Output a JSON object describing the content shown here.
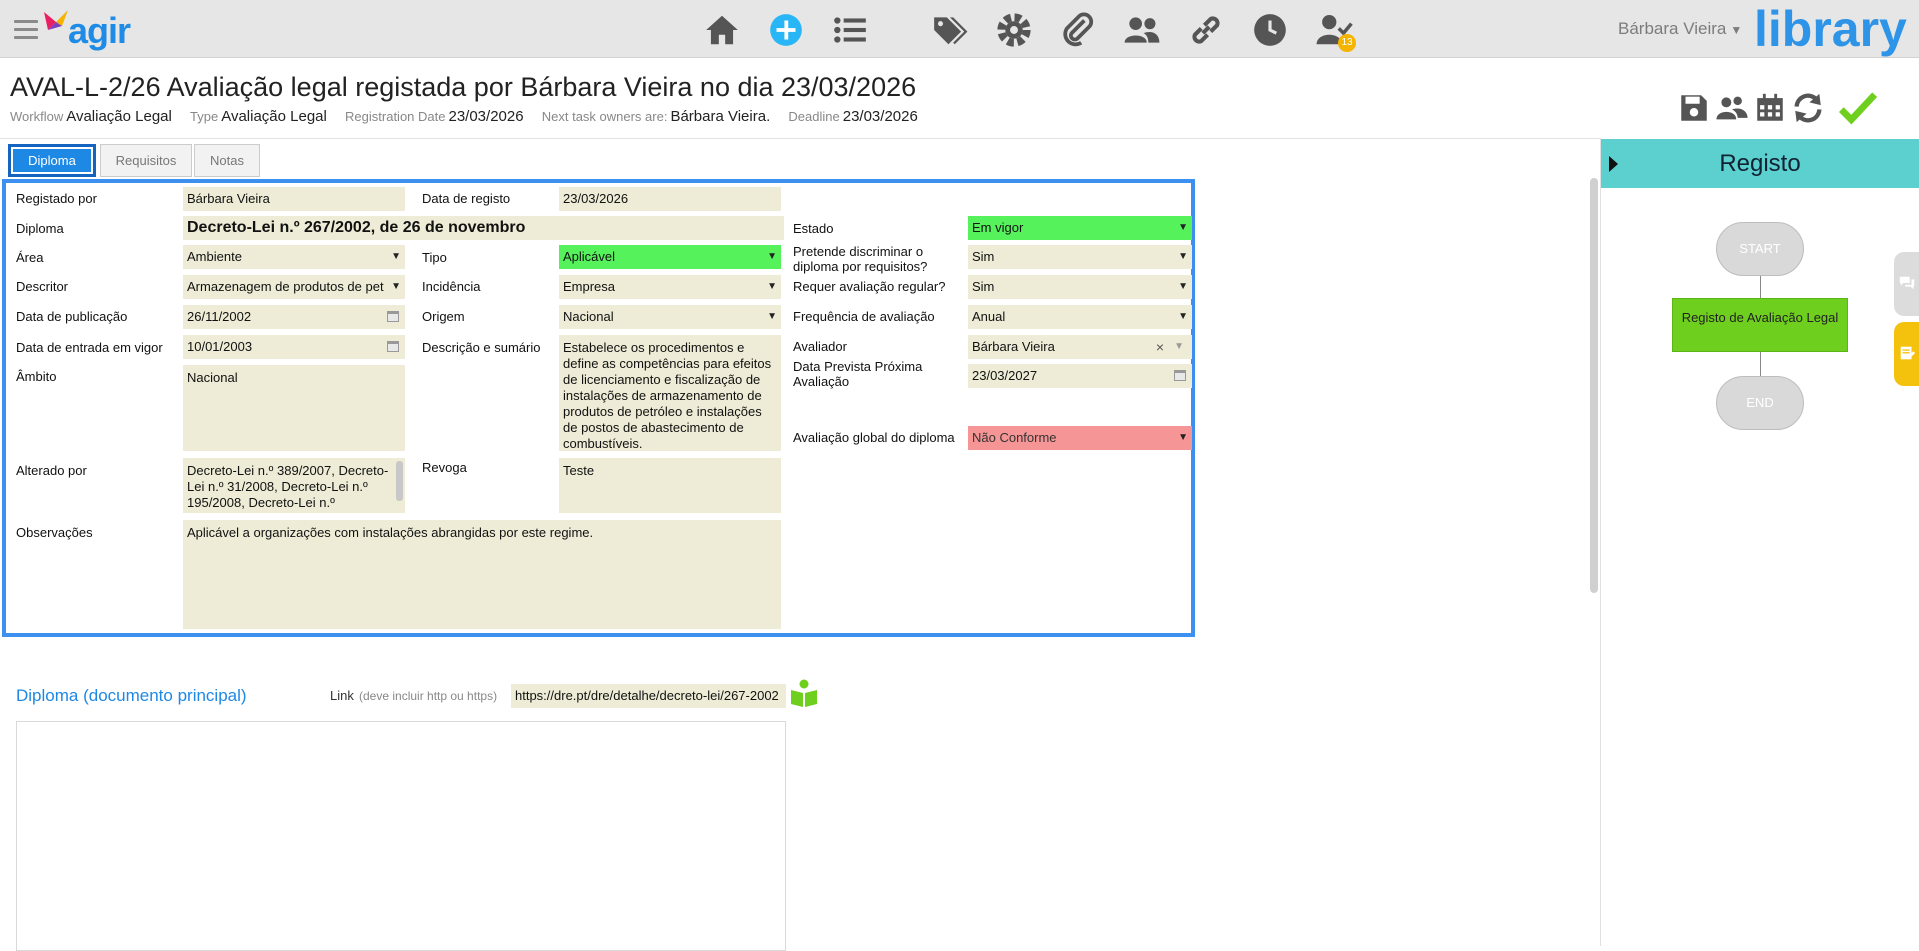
{
  "topbar": {
    "logo_text": "agir",
    "user_name": "Bárbara Vieira",
    "brand": "library",
    "notifications_count": "13",
    "nav_icons": [
      "home-icon",
      "add-icon",
      "list-icon",
      "tags-icon",
      "settings-icon",
      "attachment-icon",
      "users-icon",
      "link-icon",
      "clock-icon",
      "user-check-icon"
    ]
  },
  "header": {
    "title": "AVAL-L-2/26 Avaliação legal registada por Bárbara Vieira no dia 23/03/2026",
    "workflow_label": "Workflow",
    "workflow_value": "Avaliação Legal",
    "type_label": "Type",
    "type_value": "Avaliação Legal",
    "registration_label": "Registration Date",
    "registration_value": "23/03/2026",
    "owners_label": "Next task owners are:",
    "owners_value": "Bárbara Vieira.",
    "deadline_label": "Deadline",
    "deadline_value": "23/03/2026",
    "action_icons": [
      "save-icon",
      "group-icon",
      "calendar-icon",
      "refresh-icon",
      "check-icon"
    ]
  },
  "tabs": [
    {
      "label": "Diploma",
      "active": true
    },
    {
      "label": "Requisitos",
      "active": false
    },
    {
      "label": "Notas",
      "active": false
    }
  ],
  "form": {
    "registado_por": {
      "label": "Registado por",
      "value": "Bárbara Vieira"
    },
    "data_registo": {
      "label": "Data de registo",
      "value": "23/03/2026"
    },
    "diploma": {
      "label": "Diploma",
      "value": "Decreto-Lei n.º 267/2002, de 26 de novembro"
    },
    "estado": {
      "label": "Estado",
      "value": "Em vigor"
    },
    "area": {
      "label": "Área",
      "value": "Ambiente"
    },
    "tipo": {
      "label": "Tipo",
      "value": "Aplicável"
    },
    "discriminar": {
      "label": "Pretende discriminar o diploma por requisitos?",
      "value": "Sim"
    },
    "descritor": {
      "label": "Descritor",
      "value": "Armazenagem de produtos de pet"
    },
    "incidencia": {
      "label": "Incidência",
      "value": "Empresa"
    },
    "requer_avaliacao": {
      "label": "Requer avaliação regular?",
      "value": "Sim"
    },
    "data_publicacao": {
      "label": "Data de publicação",
      "value": "26/11/2002"
    },
    "origem": {
      "label": "Origem",
      "value": "Nacional"
    },
    "frequencia": {
      "label": "Frequência de avaliação",
      "value": "Anual"
    },
    "data_vigor": {
      "label": "Data de entrada em vigor",
      "value": "10/01/2003"
    },
    "descricao": {
      "label": "Descrição e sumário",
      "value": "Estabelece os procedimentos e define as competências para efeitos de licenciamento e fiscalização de instalações de armazenamento de produtos de petróleo e instalações de postos de abastecimento de combustíveis."
    },
    "avaliador": {
      "label": "Avaliador",
      "value": "Bárbara Vieira"
    },
    "data_prevista": {
      "label": "Data Prevista Próxima Avaliação",
      "value": "23/03/2027"
    },
    "ambito": {
      "label": "Âmbito",
      "value": "Nacional"
    },
    "avaliacao_global": {
      "label": "Avaliação global do diploma",
      "value": "Não Conforme"
    },
    "alterado_por": {
      "label": "Alterado por",
      "value": "Decreto-Lei n.º 389/2007, Decreto-Lei n.º 31/2008, Decreto-Lei n.º 195/2008, Decreto-Lei n.º"
    },
    "revoga": {
      "label": "Revoga",
      "value": "Teste"
    },
    "observacoes": {
      "label": "Observações",
      "value": "Aplicável a organizações com instalações abrangidas por este regime."
    }
  },
  "document": {
    "title": "Diploma (documento principal)",
    "link_label": "Link",
    "link_hint": "(deve incluir http ou https)",
    "link_value": "https://dre.pt/dre/detalhe/decreto-lei/267-2002"
  },
  "panel": {
    "title": "Registo",
    "start": "START",
    "task": "Registo de Avaliação Legal",
    "end": "END"
  },
  "colors": {
    "accent": "#1e88e5",
    "green_field": "#55f25c",
    "red_field": "#f69595",
    "field_bg": "#eeecd6",
    "panel_head": "#5ccfcf"
  }
}
